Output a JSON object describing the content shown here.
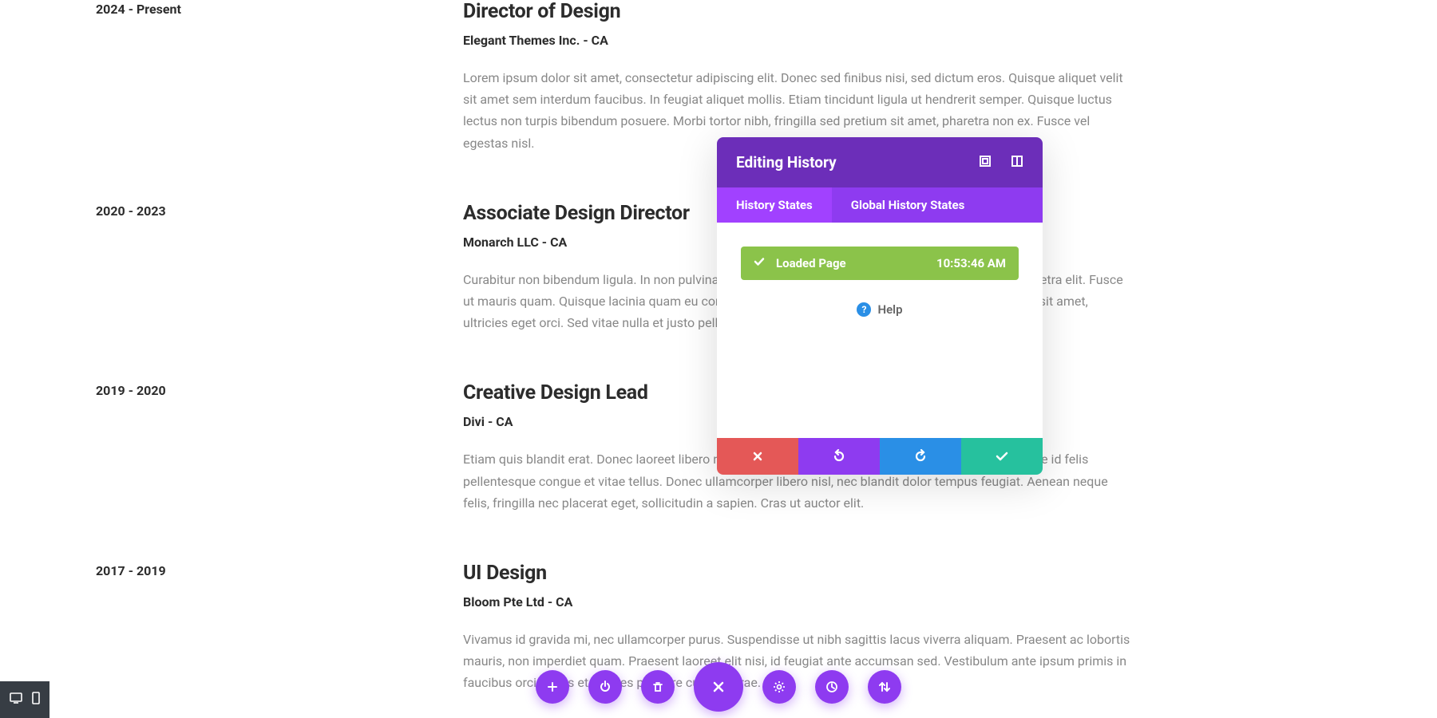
{
  "resume": [
    {
      "date": "2024 - Present",
      "title": "Director of Design",
      "company": "Elegant Themes Inc. - CA",
      "desc": "Lorem ipsum dolor sit amet, consectetur adipiscing elit. Donec sed finibus nisi, sed dictum eros. Quisque aliquet velit sit amet sem interdum faucibus. In feugiat aliquet mollis. Etiam tincidunt ligula ut hendrerit semper. Quisque luctus lectus non turpis bibendum posuere. Morbi tortor nibh, fringilla sed pretium sit amet, pharetra non ex. Fusce vel egestas nisl."
    },
    {
      "date": "2020 - 2023",
      "title": "Associate Design Director",
      "company": "Monarch LLC - CA",
      "desc": "Curabitur non bibendum ligula. In non pulvinar purus. Curabitur nisi odio, blandit et elit at, suscipit pharetra elit. Fusce ut mauris quam. Quisque lacinia quam eu commodo mollis. Praesent nisl massa, ultrices vitae ornare sit amet, ultricies eget orci. Sed vitae nulla et justo pellentesque congue nec eu risus."
    },
    {
      "date": "2019 - 2020",
      "title": "Creative Design Lead",
      "company": "Divi - CA",
      "desc": "Etiam quis blandit erat. Donec laoreet libero non metus volutpat consequat in vel metus. Sed non augue id felis pellentesque congue et vitae tellus. Donec ullamcorper libero nisl, nec blandit dolor tempus feugiat. Aenean neque felis, fringilla nec placerat eget, sollicitudin a sapien. Cras ut auctor elit."
    },
    {
      "date": "2017 - 2019",
      "title": "UI Design",
      "company": "Bloom Pte Ltd - CA",
      "desc": "Vivamus id gravida mi, nec ullamcorper purus. Suspendisse ut nibh sagittis lacus viverra aliquam. Praesent ac lobortis mauris, non imperdiet quam. Praesent laoreet elit nisi, id feugiat ante accumsan sed. Vestibulum ante ipsum primis in faucibus orci luctus et ultrices posuere cubilia curae."
    }
  ],
  "panel": {
    "title": "Editing History",
    "tabs": [
      "History States",
      "Global History States"
    ],
    "history_item": {
      "label": "Loaded Page",
      "time": "10:53:46 AM"
    },
    "help": "Help"
  }
}
